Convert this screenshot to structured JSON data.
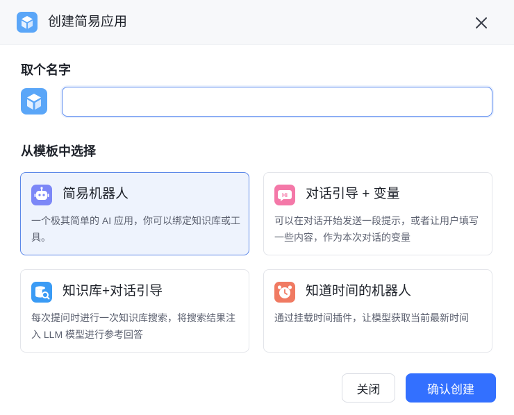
{
  "dialog": {
    "title": "创建简易应用",
    "icon": "cube-app-icon"
  },
  "name_section": {
    "title": "取个名字",
    "avatar_icon": "cube-app-icon",
    "input_value": "",
    "input_placeholder": ""
  },
  "template_section": {
    "title": "从模板中选择",
    "selected_index": 0,
    "templates": [
      {
        "title": "简易机器人",
        "description": "一个极其简单的 AI 应用，你可以绑定知识库或工具。",
        "icon": "robot-icon",
        "color": "#7c87f7"
      },
      {
        "title": "对话引导 + 变量",
        "description": "可以在对话开始发送一段提示，或者让用户填写一些内容，作为本次对话的变量",
        "icon": "hi-chat-icon",
        "color": "#f478a8"
      },
      {
        "title": "知识库+对话引导",
        "description": "每次提问时进行一次知识库搜索，将搜索结果注入 LLM 模型进行参考回答",
        "icon": "database-search-icon",
        "color": "#3a9bf5"
      },
      {
        "title": "知道时间的机器人",
        "description": "通过挂载时间插件，让模型获取当前最新时间",
        "icon": "alarm-clock-icon",
        "color": "#f07a62"
      }
    ]
  },
  "footer": {
    "close_label": "关闭",
    "confirm_label": "确认创建"
  },
  "colors": {
    "primary": "#3370ff",
    "selected_card_bg": "#eef3fd",
    "selected_card_border": "#5b87e8"
  }
}
